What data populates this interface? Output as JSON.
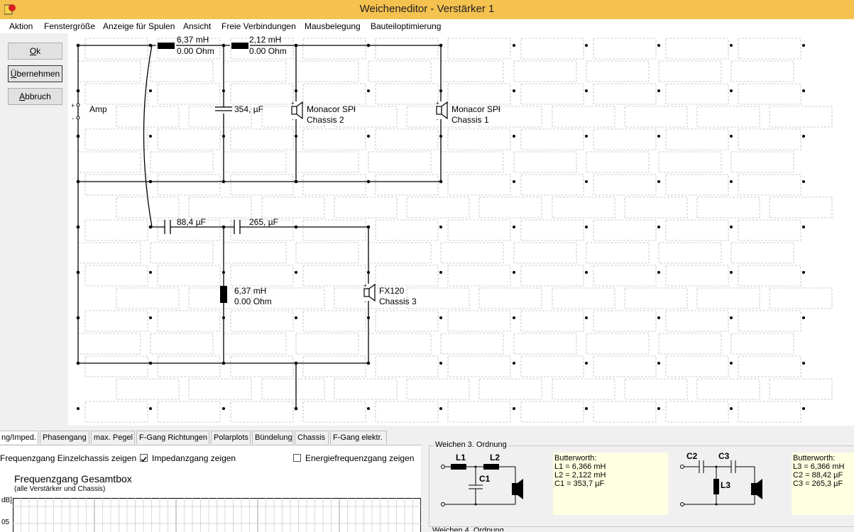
{
  "window": {
    "title": "Weicheneditor - Verstärker 1"
  },
  "menu": [
    "Aktion",
    "Fenstergröße",
    "Anzeige für Spulen",
    "Ansicht",
    "Freie Verbindungen",
    "Mausbelegung",
    "Bauteiloptimierung"
  ],
  "buttons": {
    "ok": "Ok",
    "apply": "Übernehmen",
    "cancel": "Abbruch"
  },
  "circuit": {
    "amp": {
      "label": "Amp",
      "plus": "+",
      "minus": "-"
    },
    "l1": {
      "value": "6,37 mH",
      "res": "0.00 Ohm"
    },
    "l2": {
      "value": "2,12 mH",
      "res": "0.00 Ohm"
    },
    "c1": {
      "value": "354, µF"
    },
    "chassis2": {
      "name": "Monacor SPł",
      "label": "Chassis 2"
    },
    "chassis1": {
      "name": "Monacor SPł",
      "label": "Chassis 1"
    },
    "c2": {
      "value": "88,4 µF"
    },
    "c3": {
      "value": "265, µF"
    },
    "l3": {
      "value": "6,37 mH",
      "res": "0.00 Ohm"
    },
    "chassis3": {
      "name": "FX120",
      "label": "Chassis 3"
    }
  },
  "tabs": [
    "ng/Imped.",
    "Phasengang",
    "max. Pegel",
    "F-Gang Richtungen",
    "Polarplots",
    "Bündelung",
    "Chassis",
    "F-Gang elektr."
  ],
  "options": {
    "single": {
      "label": "Frequenzgang Einzelchassis zeigen",
      "checked": false
    },
    "impedance": {
      "label": "Impedanzgang zeigen",
      "checked": true
    },
    "energy": {
      "label": "Energiefrequenzgang zeigen",
      "checked": false
    }
  },
  "plot": {
    "title": "Frequenzgang Gesamtbox",
    "subtitle": "(alle Verstärker und Chassis)",
    "unit": "dB]",
    "tick": "05"
  },
  "reference": {
    "group_title": "Weichen 3. Ordnung",
    "lowpass": {
      "labels": [
        "L1",
        "L2",
        "C1"
      ],
      "note": [
        "Butterworth:",
        "L1 = 6,366 mH",
        "L2 = 2,122 mH",
        "C1 = 353,7 µF"
      ]
    },
    "highpass": {
      "labels": [
        "C2",
        "C3",
        "L3"
      ],
      "note": [
        "Butterworth:",
        "L3 = 6,366 mH",
        "C2 = 88,42 µF",
        "C3 = 265,3 µF"
      ]
    },
    "next_group_title": "Weichen 4. Ordnung"
  }
}
